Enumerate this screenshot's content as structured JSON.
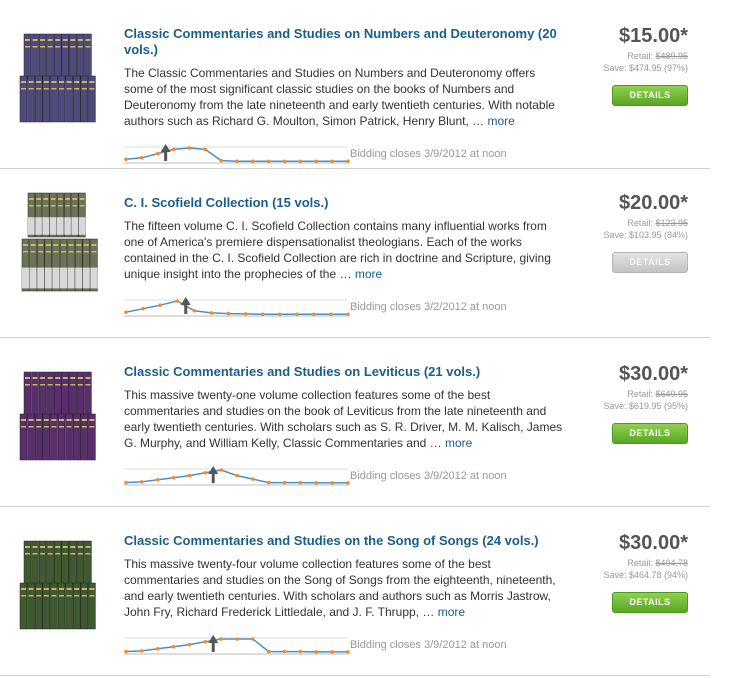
{
  "items": [
    {
      "title": "Classic Commentaries and Studies on Numbers and Deuteronomy (20 vols.)",
      "description": "The Classic Commentaries and Studies on Numbers and Deuteronomy offers some of the most significant classic studies on the books of Numbers and Deuteronomy from the late nineteenth and early twentieth centuries. With notable authors such as Richard G. Moulton, Simon Patrick, Henry Blunt, …",
      "more": "more",
      "price": "$15.00*",
      "retail_label": "Retail:",
      "retail": "$489.95",
      "save": "Save: $474.95 (97%)",
      "button": "DETAILS",
      "button_state": "active",
      "bidding": "Bidding closes 3/9/2012 at noon",
      "book_color": "#4e4a7c",
      "spark": [
        0.2,
        0.3,
        0.6,
        0.9,
        1.0,
        0.9,
        0.1,
        0.05,
        0.05,
        0.05,
        0.05,
        0.05,
        0.05,
        0.05,
        0.05
      ],
      "spark_marker": 2
    },
    {
      "title": "C. I. Scofield Collection (15 vols.)",
      "description": "The fifteen volume C. I. Scofield Collection contains many influential works from one of America's premiere dispensationalist theologians. Each of the works contained in the C. I. Scofield Collection are rich in doctrine and Scripture, giving unique insight into the prophecies of the …",
      "more": "more",
      "price": "$20.00*",
      "retail_label": "Retail:",
      "retail": "$123.95",
      "save": "Save: $103.95 (84%)",
      "button": "DETAILS",
      "button_state": "disabled",
      "bidding": "Bidding closes 3/2/2012 at noon",
      "book_color": "#6b7456",
      "spark": [
        0.2,
        0.45,
        0.7,
        1.0,
        0.3,
        0.15,
        0.1,
        0.08,
        0.05,
        0.05,
        0.05,
        0.05,
        0.05,
        0.05
      ],
      "spark_marker": 3
    },
    {
      "title": "Classic Commentaries and Studies on Leviticus (21 vols.)",
      "description": "This massive twenty-one volume collection features some of the best commentaries and studies on the book of Leviticus from the late nineteenth and early twentieth centuries. With scholars such as S. R. Driver, M. M. Kalisch, James G. Murphy, and William Kelly, Classic Commentaries and …",
      "more": "more",
      "price": "$30.00*",
      "retail_label": "Retail:",
      "retail": "$649.95",
      "save": "Save: $619.95 (95%)",
      "button": "DETAILS",
      "button_state": "active",
      "bidding": "Bidding closes 3/9/2012 at noon",
      "book_color": "#5a2e6e",
      "spark": [
        0.1,
        0.15,
        0.3,
        0.45,
        0.6,
        0.8,
        1.0,
        0.6,
        0.35,
        0.1,
        0.1,
        0.1,
        0.08,
        0.08,
        0.08
      ],
      "spark_marker": 5
    },
    {
      "title": "Classic Commentaries and Studies on the Song of Songs (24 vols.)",
      "description": "This massive twenty-four volume collection features some of the best commentaries and studies on the Song of Songs from the eighteenth, nineteenth, and early twentieth centuries. With scholars and authors such as Morris Jastrow, John Fry, Richard Frederick Littledale, and J. F. Thrupp, …",
      "more": "more",
      "price": "$30.00*",
      "retail_label": "Retail:",
      "retail": "$494.78",
      "save": "Save: $464.78 (94%)",
      "button": "DETAILS",
      "button_state": "active",
      "bidding": "Bidding closes 3/9/2012 at noon",
      "book_color": "#3e5a2e",
      "spark": [
        0.1,
        0.15,
        0.3,
        0.45,
        0.6,
        0.8,
        1.0,
        1.0,
        1.0,
        0.1,
        0.1,
        0.1,
        0.08,
        0.08,
        0.08
      ],
      "spark_marker": 5
    }
  ]
}
